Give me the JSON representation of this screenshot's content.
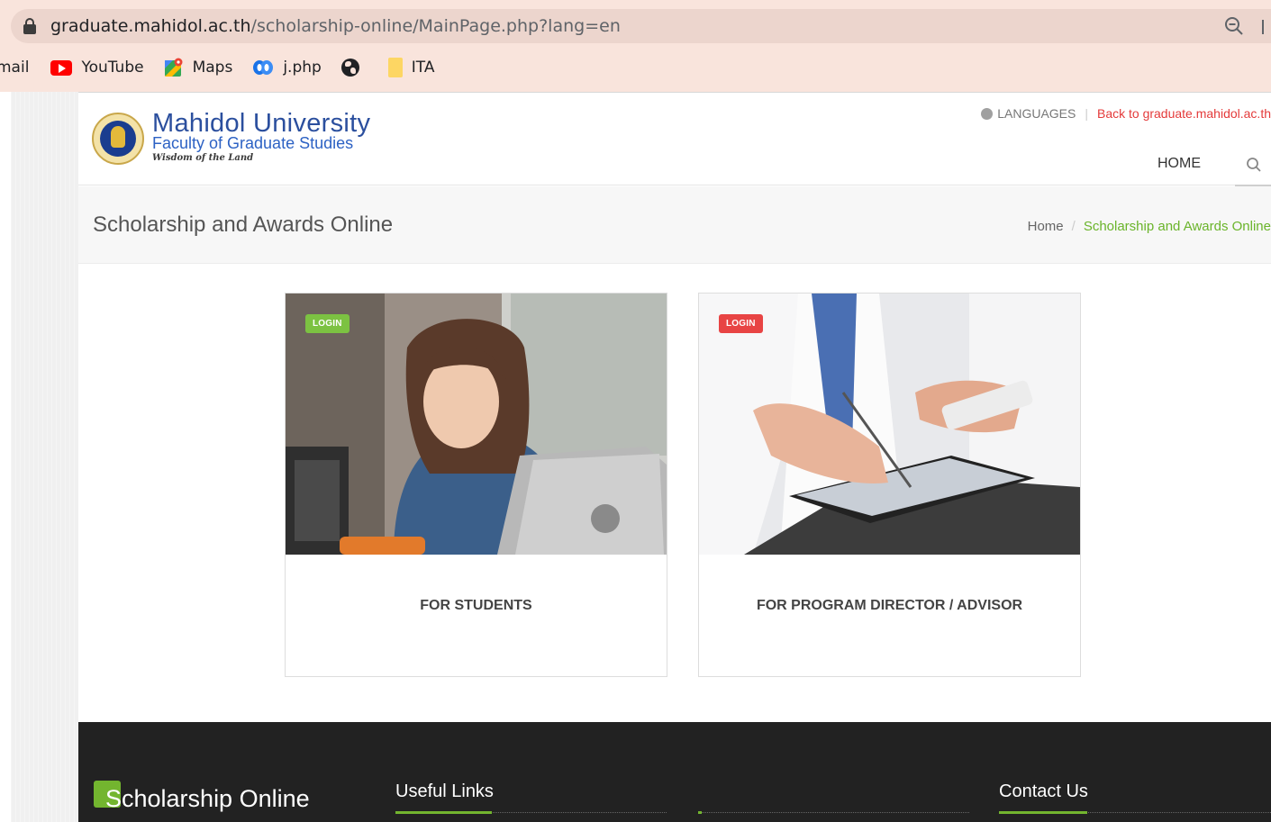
{
  "browser": {
    "url_host": "graduate.mahidol.ac.th",
    "url_path": "/scholarship-online/MainPage.php?lang=en",
    "bookmarks": [
      {
        "label": "mail",
        "icon": "none"
      },
      {
        "label": "YouTube",
        "icon": "youtube-icon"
      },
      {
        "label": "Maps",
        "icon": "maps-icon"
      },
      {
        "label": "j.php",
        "icon": "meetingworks-icon"
      },
      {
        "label": "",
        "icon": "globe-icon"
      },
      {
        "label": "ITA",
        "icon": "folder-icon"
      }
    ]
  },
  "header": {
    "brand_line1": "Mahidol University",
    "brand_line2": "Faculty of Graduate Studies",
    "brand_line3": "Wisdom of the Land",
    "languages_label": "LANGUAGES",
    "back_link": "Back to graduate.mahidol.ac.th",
    "nav_home": "HOME"
  },
  "titlebar": {
    "title": "Scholarship and Awards Online",
    "breadcrumb_home": "Home",
    "breadcrumb_current": "Scholarship and Awards Online"
  },
  "cards": [
    {
      "badge": "LOGIN",
      "label": "FOR STUDENTS",
      "badge_color": "#7cc242"
    },
    {
      "badge": "LOGIN",
      "label": "FOR PROGRAM DIRECTOR / ADVISOR",
      "badge_color": "#e84444"
    }
  ],
  "footer": {
    "logo_text": "Scholarship Online",
    "useful_links": "Useful Links",
    "contact_us": "Contact Us"
  },
  "colors": {
    "accent_green": "#6ab42a",
    "accent_red": "#e43a3a",
    "footer_bg": "#222222"
  }
}
